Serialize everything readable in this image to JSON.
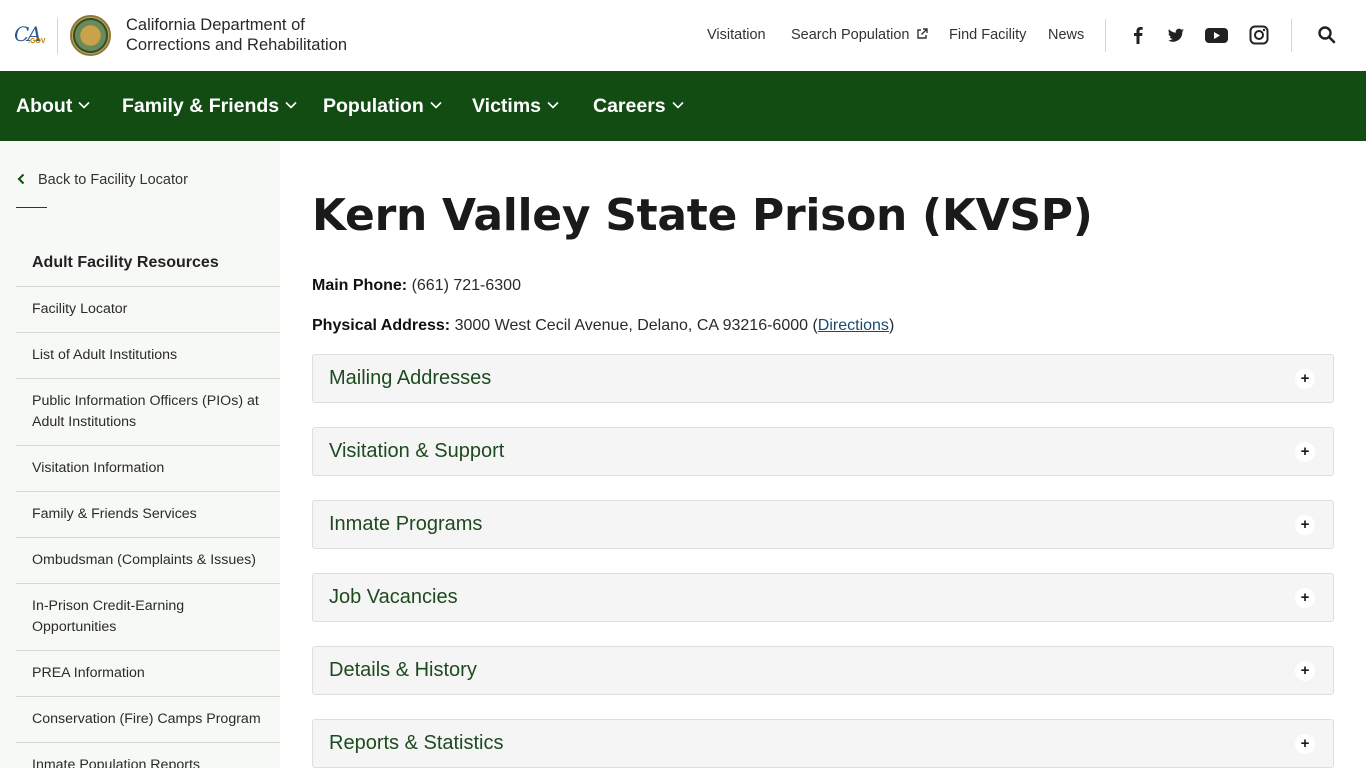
{
  "header": {
    "org_line1": "California Department of",
    "org_line2": "Corrections and Rehabilitation",
    "ca_logo_text": "CA",
    "ca_logo_sub": ".GOV",
    "utility_links": [
      {
        "label": "Visitation"
      },
      {
        "label": "Search Population",
        "icon": "external-link-icon"
      },
      {
        "label": "Find Facility"
      },
      {
        "label": "News"
      }
    ],
    "social": [
      "facebook-icon",
      "twitter-icon",
      "youtube-icon",
      "instagram-icon"
    ],
    "search_icon": "search-icon"
  },
  "nav": {
    "items": [
      {
        "label": "About"
      },
      {
        "label": "Family & Friends"
      },
      {
        "label": "Population"
      },
      {
        "label": "Victims"
      },
      {
        "label": "Careers"
      }
    ]
  },
  "sidebar": {
    "back_label": "Back to Facility Locator",
    "heading": "Adult Facility Resources",
    "items": [
      {
        "label": "Facility Locator"
      },
      {
        "label": "List of Adult Institutions"
      },
      {
        "label": "Public Information Officers (PIOs) at Adult Institutions"
      },
      {
        "label": "Visitation Information"
      },
      {
        "label": "Family & Friends Services"
      },
      {
        "label": "Ombudsman (Complaints & Issues)"
      },
      {
        "label": "In-Prison Credit-Earning Opportunities"
      },
      {
        "label": "PREA Information"
      },
      {
        "label": "Conservation (Fire) Camps Program"
      },
      {
        "label": "Inmate Population Reports"
      }
    ]
  },
  "main": {
    "title": "Kern Valley State Prison (KVSP)",
    "phone_label": "Main Phone:",
    "phone_value": "(661) 721-6300",
    "address_label": "Physical Address:",
    "address_value": "3000 West Cecil Avenue, Delano, CA 93216-6000 (",
    "directions_label": "Directions",
    "address_close": ")",
    "accordions": [
      {
        "label": "Mailing Addresses"
      },
      {
        "label": "Visitation & Support"
      },
      {
        "label": "Inmate Programs"
      },
      {
        "label": "Job Vacancies"
      },
      {
        "label": "Details & History"
      },
      {
        "label": "Reports & Statistics"
      }
    ],
    "plus_symbol": "+"
  },
  "colors": {
    "nav_green": "#124c13",
    "accordion_text": "#1e4a1f",
    "link_blue": "#1c4a6e"
  }
}
